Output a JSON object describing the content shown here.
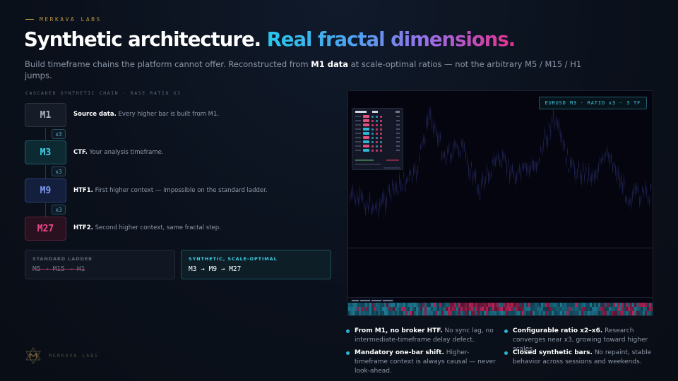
{
  "header": {
    "eyebrow": "MERKAVA LABS",
    "headline_white": "Synthetic architecture.",
    "headline_gradient": "Real fractal dimensions.",
    "subtitle_pre": "Build timeframe chains the platform cannot offer. Reconstructed from ",
    "subtitle_bold": "M1 data",
    "subtitle_post": " at scale-optimal ratios — not the arbitrary M5 / M15 / H1 jumps."
  },
  "chain": {
    "label": "CASCADED SYNTHETIC CHAIN · BASE RATIO X3",
    "ratio_label": "x3",
    "levels": [
      {
        "tf": "M1",
        "bold": "Source data.",
        "text": " Every higher bar is built from M1.",
        "color": "#aab3c2"
      },
      {
        "tf": "M3",
        "bold": "CTF.",
        "text": " Your analysis timeframe.",
        "color": "#3fd0e6"
      },
      {
        "tf": "M9",
        "bold": "HTF1.",
        "text": " First higher context — impossible on the standard ladder.",
        "color": "#7b98f0"
      },
      {
        "tf": "M27",
        "bold": "HTF2.",
        "text": " Second higher context, same fractal step.",
        "color": "#ee4a8c"
      }
    ]
  },
  "ladders": {
    "standard": {
      "title": "STANDARD LADDER",
      "value": "M5 → M15 → H1"
    },
    "synthetic": {
      "title": "SYNTHETIC, SCALE-OPTIMAL",
      "value": "M3 → M9 → M27"
    }
  },
  "chart": {
    "badge": "EURUSD M3 · RATIO x3 · 3 TF",
    "candle_color": "#1c1f4a",
    "strip_cyan": "#1f7f9a",
    "strip_pink": "#c2275f"
  },
  "bullets": [
    {
      "bold": "From M1, no broker HTF.",
      "text": " No sync lag, no intermediate-timeframe delay defect."
    },
    {
      "bold": "Configurable ratio x2–x6.",
      "text": " Research converges near x3, growing toward higher scales."
    },
    {
      "bold": "Mandatory one-bar shift.",
      "text": " Higher-timeframe context is always causal — never look-ahead."
    },
    {
      "bold": "Closed synthetic bars.",
      "text": " No repaint, stable behavior across sessions and weekends."
    }
  ],
  "brand": {
    "name": "MERKAVA LABS",
    "accent": "#b8913c"
  }
}
